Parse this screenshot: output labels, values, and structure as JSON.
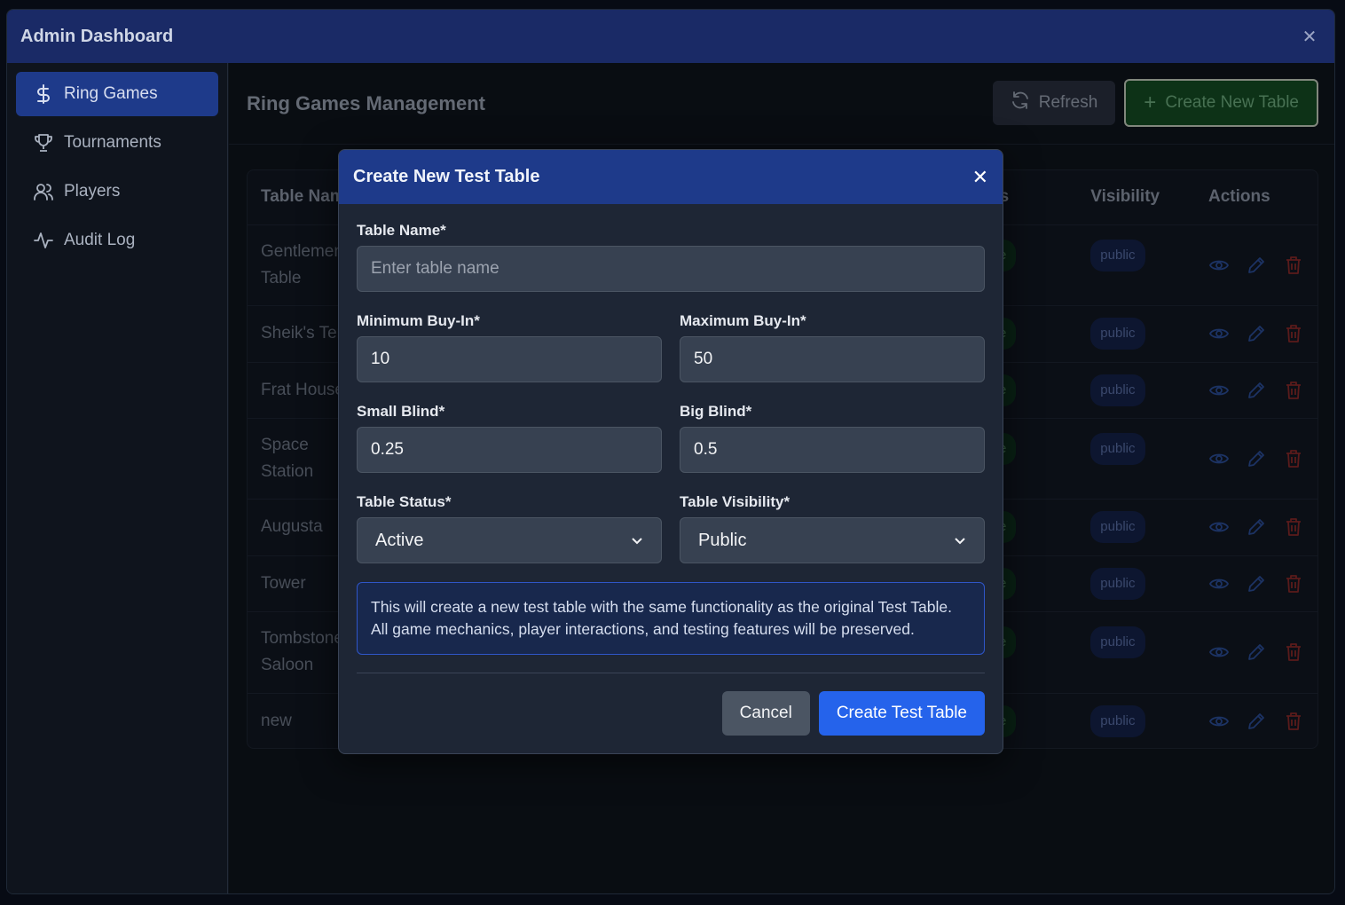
{
  "window": {
    "title": "Admin Dashboard"
  },
  "sidebar": {
    "items": [
      {
        "label": "Ring Games",
        "icon": "dollar-icon",
        "active": true
      },
      {
        "label": "Tournaments",
        "icon": "trophy-icon",
        "active": false
      },
      {
        "label": "Players",
        "icon": "users-icon",
        "active": false
      },
      {
        "label": "Audit Log",
        "icon": "activity-icon",
        "active": false
      }
    ]
  },
  "main": {
    "title": "Ring Games Management",
    "refresh_label": "Refresh",
    "create_label": "Create New Table",
    "table": {
      "headers": {
        "name": "Table Nam",
        "status": "us",
        "visibility": "Visibility",
        "actions": "Actions"
      },
      "rows": [
        {
          "name": "Gentlemen's\nTable",
          "name_l1": "Gentlemen",
          "name_l2": "Table",
          "status": "e",
          "visibility": "public"
        },
        {
          "name_l1": "Sheik's Ter",
          "name_l2": "",
          "status": "e",
          "visibility": "public"
        },
        {
          "name_l1": "Frat House",
          "name_l2": "",
          "status": "e",
          "visibility": "public"
        },
        {
          "name_l1": "Space",
          "name_l2": "Station",
          "status": "e",
          "visibility": "public"
        },
        {
          "name_l1": "Augusta",
          "name_l2": "",
          "status": "e",
          "visibility": "public"
        },
        {
          "name_l1": "Tower",
          "name_l2": "",
          "status": "e",
          "visibility": "public"
        },
        {
          "name_l1": "Tombstone",
          "name_l2": "Saloon",
          "status": "e",
          "visibility": "public"
        },
        {
          "name_l1": "new",
          "name_l2": "",
          "status": "e",
          "visibility": "public"
        }
      ]
    }
  },
  "modal": {
    "title": "Create New Test Table",
    "table_name": {
      "label": "Table Name*",
      "placeholder": "Enter table name",
      "value": ""
    },
    "min_buyin": {
      "label": "Minimum Buy-In*",
      "value": "10"
    },
    "max_buyin": {
      "label": "Maximum Buy-In*",
      "value": "50"
    },
    "small_blind": {
      "label": "Small Blind*",
      "value": "0.25"
    },
    "big_blind": {
      "label": "Big Blind*",
      "value": "0.5"
    },
    "status": {
      "label": "Table Status*",
      "value": "Active"
    },
    "visibility": {
      "label": "Table Visibility*",
      "value": "Public"
    },
    "info": "This will create a new test table with the same functionality as the original Test Table. All game mechanics, player interactions, and testing features will be preserved.",
    "cancel_label": "Cancel",
    "submit_label": "Create Test Table"
  },
  "colors": {
    "accent": "#1e3a8a",
    "primary_button": "#2563eb",
    "success_button": "#144d24",
    "background": "#0f141d"
  }
}
